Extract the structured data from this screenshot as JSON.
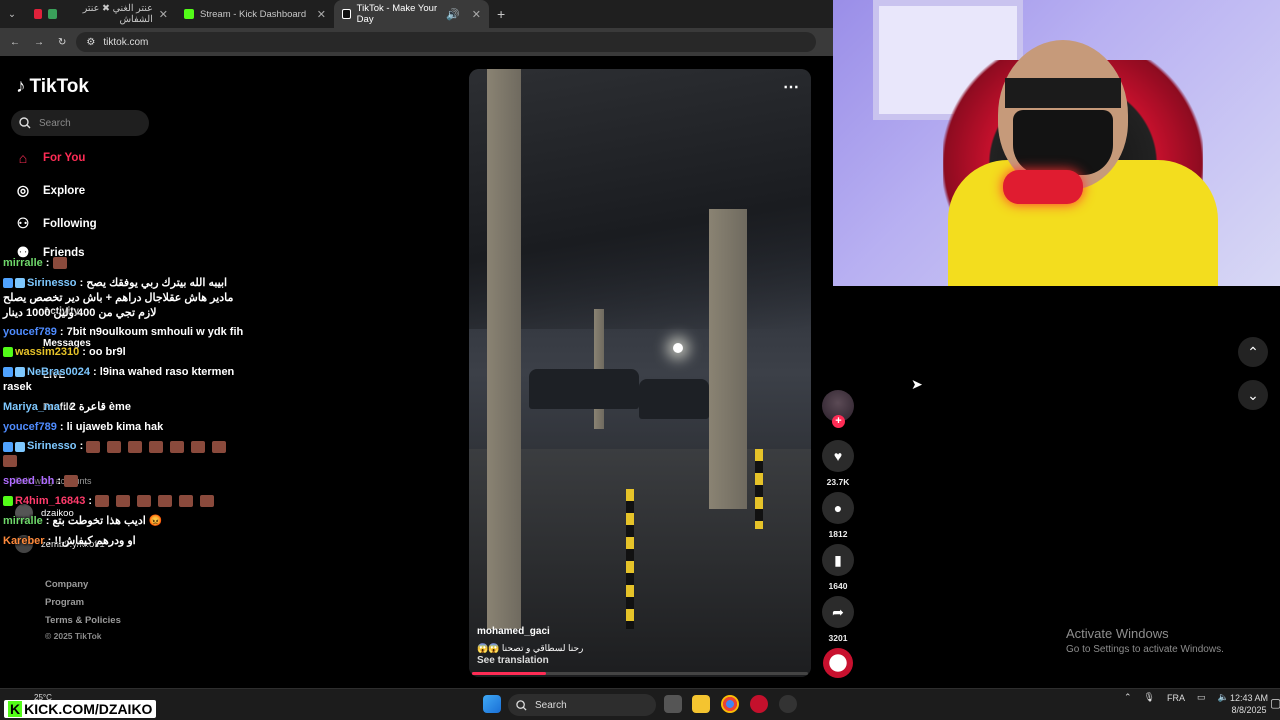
{
  "browser": {
    "tabs": [
      {
        "label": "عنتر الغني ✖ عنتر الشفاش",
        "active": false
      },
      {
        "label": "Stream - Kick Dashboard",
        "active": false
      },
      {
        "label": "TikTok - Make Your Day",
        "active": true
      }
    ],
    "url": "tiktok.com"
  },
  "tiktok": {
    "logo": "TikTok",
    "search_placeholder": "Search",
    "nav": [
      {
        "label": "For You",
        "icon": "home-icon",
        "active": true
      },
      {
        "label": "Explore",
        "icon": "compass-icon"
      },
      {
        "label": "Following",
        "icon": "following-icon"
      },
      {
        "label": "Friends",
        "icon": "friends-icon"
      },
      {
        "label": "Activity",
        "icon": "activity-icon"
      },
      {
        "label": "Messages",
        "icon": "messages-icon"
      },
      {
        "label": "LIVE",
        "icon": "live-icon"
      },
      {
        "label": "Profile",
        "icon": "profile-icon"
      }
    ],
    "following_accounts_label": "Following accounts",
    "following_accounts": [
      {
        "name": "dzaikoo"
      },
      {
        "name": "zemb9.y/ki.off1"
      }
    ],
    "footer": [
      "Company",
      "Program",
      "Terms & Policies"
    ],
    "copyright": "© 2025 TikTok",
    "video": {
      "author": "mohamed_gaci",
      "caption": "رحنا لسطاقي و تصحنا 😱😱",
      "see_translation": "See translation",
      "progress_fraction": 0.22
    },
    "actions": {
      "likes": "23.7K",
      "comments": "1812",
      "saves": "1640",
      "shares": "3201"
    }
  },
  "chat": [
    {
      "user": "mirralle",
      "user_color": "#6fd96b",
      "text": ""
    },
    {
      "user": "Sirinesso",
      "user_color": "#7ec8ff",
      "text": "ابيبه الله بيترك ربي يوفقك يصح مادير هاش عقلاجال دراهم + باش دير تخصص يصلح لازم تجي من 400 ولين 1000 دينار"
    },
    {
      "user": "youcef789",
      "user_color": "#4f8cff",
      "text": "7bit n9oulkoum smhouli w ydk fih"
    },
    {
      "user": "wassim2310",
      "user_color": "#e6c329",
      "text": "oo br9l"
    },
    {
      "user": "NeBras0024",
      "user_color": "#7ec8ff",
      "text": "l9ina wahed raso ktermen rasek"
    },
    {
      "user": "Mariya_ma",
      "user_color": "#7ec8ff",
      "text": "2 قاعرة ème"
    },
    {
      "user": "youcef789",
      "user_color": "#4f8cff",
      "text": "li ujaweb kima hak"
    },
    {
      "user": "Sirinesso",
      "user_color": "#7ec8ff",
      "text": ""
    },
    {
      "user": "speed_bh",
      "user_color": "#b06cff",
      "text": ""
    },
    {
      "user": "R4him_16843",
      "user_color": "#ff3b6b",
      "text": ""
    },
    {
      "user": "mirralle",
      "user_color": "#6fd96b",
      "text": "اديب هذا تخوطت بتع 😡"
    },
    {
      "user": "Kareber",
      "user_color": "#ff8a3c",
      "text": "!!او ودرهم كيفاش"
    }
  ],
  "desktop": {
    "activate_title": "Activate Windows",
    "activate_sub": "Go to Settings to activate Windows.",
    "kick_handle": "KICK.COM/DZAIKO",
    "weather": "25°C",
    "taskbar_search": "Search",
    "language": "FRA",
    "time": "12:43 AM",
    "date": "8/8/2025"
  }
}
